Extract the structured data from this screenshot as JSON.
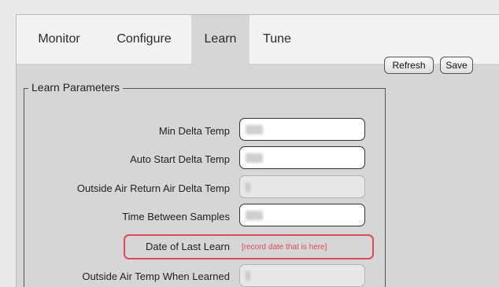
{
  "tabs": [
    {
      "label": "Monitor"
    },
    {
      "label": "Configure"
    },
    {
      "label": "Learn"
    },
    {
      "label": "Tune"
    }
  ],
  "active_tab": "Learn",
  "toolbar": {
    "refresh_label": "Refresh",
    "save_label": "Save"
  },
  "learn_parameters": {
    "legend": "Learn Parameters",
    "fields": [
      {
        "label": "Min Delta Temp",
        "editable": true
      },
      {
        "label": "Auto Start Delta Temp",
        "editable": true
      },
      {
        "label": "Outside Air Return Air Delta Temp",
        "editable": false
      },
      {
        "label": "Time Between Samples",
        "editable": true
      },
      {
        "label": "Date of Last Learn",
        "value": "[record date that is here]",
        "highlighted": true
      },
      {
        "label": "Outside Air Temp When Learned",
        "editable": false
      }
    ]
  },
  "colors": {
    "highlight": "#e04a57",
    "panel": "#d6d6d6",
    "tabbar": "#f3f3f3"
  }
}
